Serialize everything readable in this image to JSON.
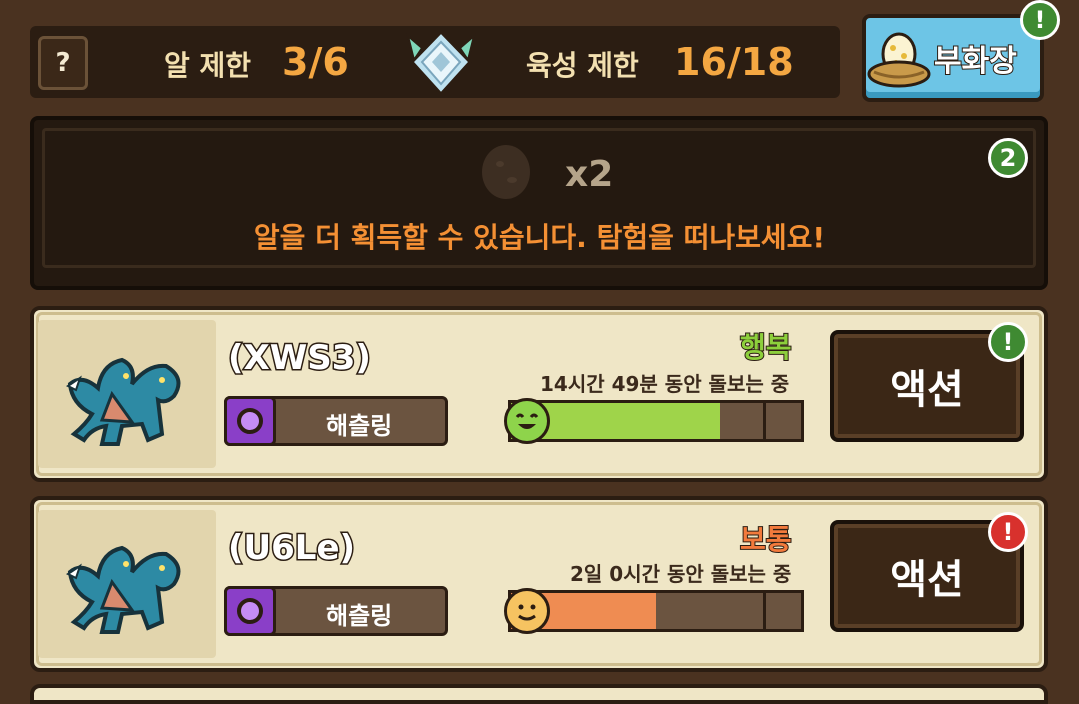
{
  "header": {
    "help_label": "?",
    "egg_limit_label": "알 제한",
    "egg_limit_value": "3/6",
    "raise_limit_label": "육성 제한",
    "raise_limit_value": "16/18",
    "hatchery_label": "부화장",
    "hatchery_badge": "!"
  },
  "egg_panel": {
    "count": "x2",
    "message": "알을 더 획득할 수 있습니다. 탐험을 떠나보세요!",
    "badge": "2"
  },
  "pets": [
    {
      "name": "(XWS3)",
      "type": "해츨링",
      "mood": "행복",
      "mood_color": "#8dcf3c",
      "care_time": "14시간 49분 동안 돌보는 중",
      "fill_fraction": 0.72,
      "bar_color": "#9fd44a",
      "action_label": "액션",
      "badge": "!",
      "badge_color": "green"
    },
    {
      "name": "(U6Le)",
      "type": "해츨링",
      "mood": "보통",
      "mood_color": "#f27a3c",
      "care_time": "2일 0시간 동안 돌보는 중",
      "fill_fraction": 0.5,
      "bar_color": "#ef8c52",
      "action_label": "액션",
      "badge": "!",
      "badge_color": "red"
    }
  ]
}
